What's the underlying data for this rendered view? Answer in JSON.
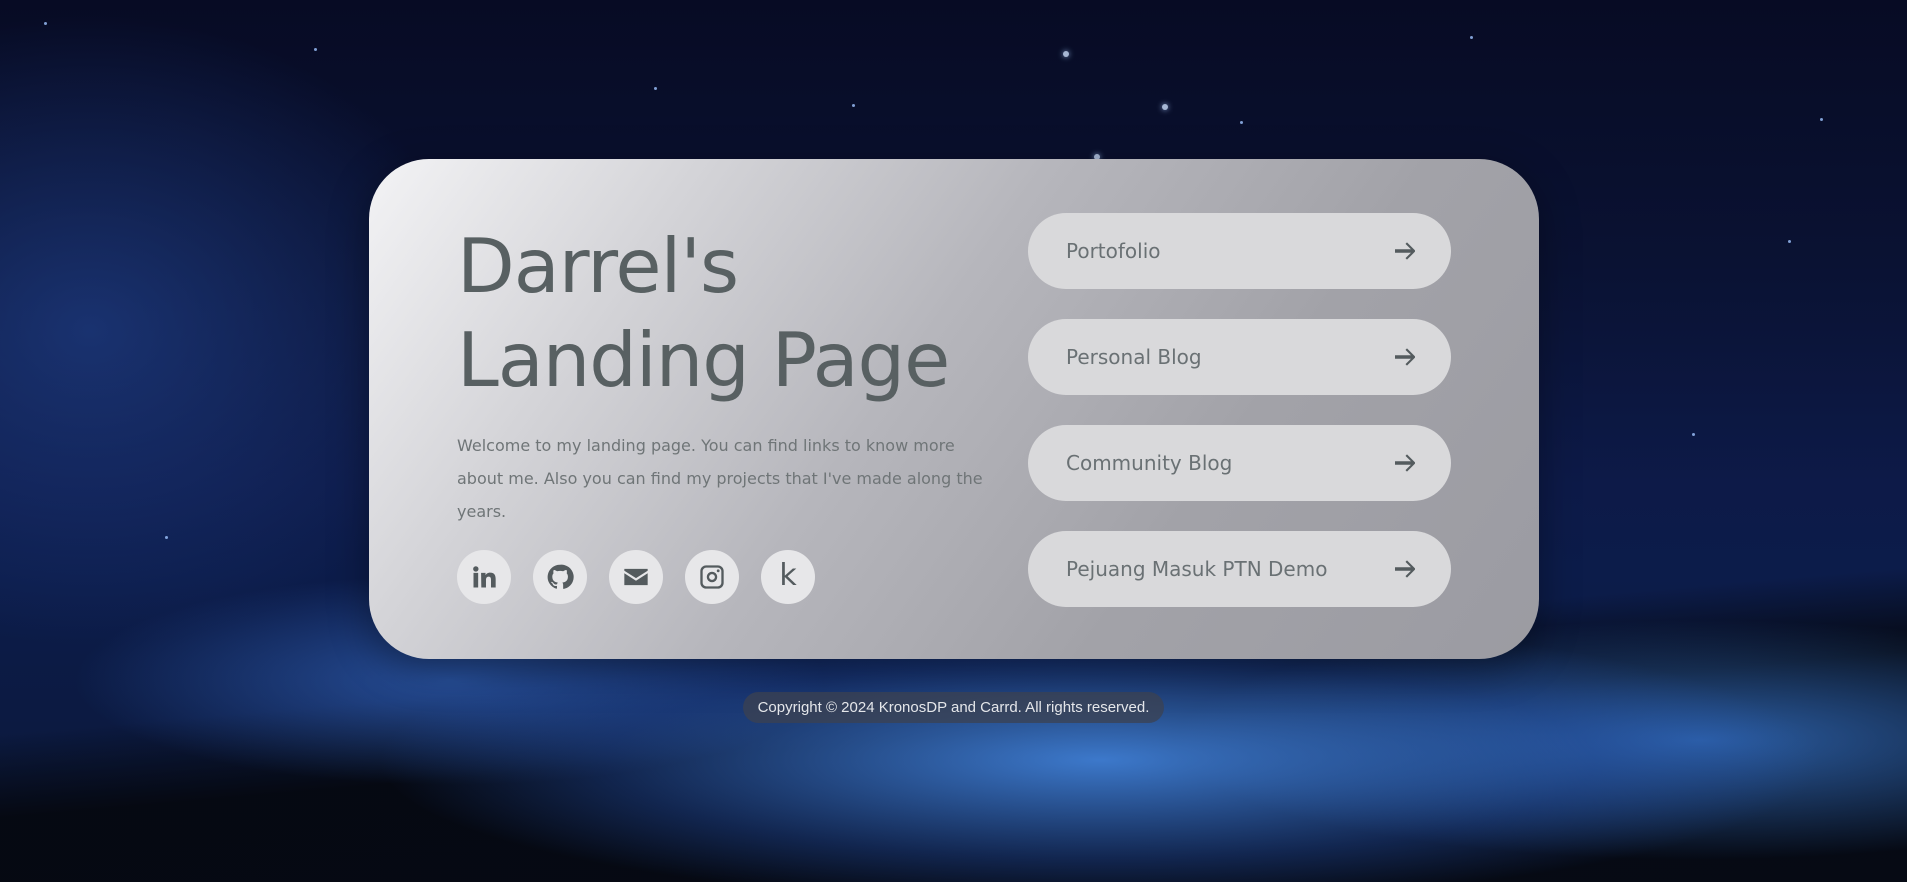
{
  "page": {
    "title_line1": "Darrel's",
    "title_line2": "Landing Page",
    "description": "Welcome to my landing page. You can find links to know more about me. Also you can find my projects that I've made along the years."
  },
  "socials": [
    {
      "icon": "linkedin-icon"
    },
    {
      "icon": "github-icon"
    },
    {
      "icon": "envelope-icon"
    },
    {
      "icon": "instagram-icon"
    },
    {
      "icon": "kaggle-icon",
      "glyph": "k"
    }
  ],
  "links": [
    {
      "label": "Portofolio",
      "icon": "arrow-right-icon"
    },
    {
      "label": "Personal Blog",
      "icon": "arrow-right-icon"
    },
    {
      "label": "Community Blog",
      "icon": "arrow-right-icon"
    },
    {
      "label": "Pejuang Masuk PTN Demo",
      "icon": "arrow-right-icon"
    }
  ],
  "footer": {
    "text": "Copyright © 2024 KronosDP and Carrd. All rights reserved."
  },
  "colors": {
    "card_text": "#586062",
    "button_bg": "#d9d9db",
    "icon_circle_bg": "#e7e7e9"
  }
}
